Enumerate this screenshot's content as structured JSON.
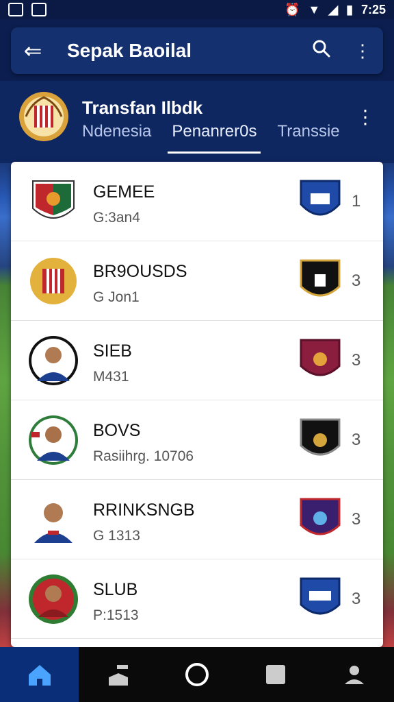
{
  "status_bar": {
    "time": "7:25"
  },
  "app_bar": {
    "title": "Sepak Baoilal",
    "back_icon": "arrow-left-icon",
    "search_icon": "search-icon",
    "more_icon": "more-vert-icon"
  },
  "header": {
    "title": "Transfan Ilbdk",
    "tabs": [
      {
        "label": "Ndenesia"
      },
      {
        "label": "Penanrer0s"
      },
      {
        "label": "Transsie"
      }
    ],
    "active_tab": 1
  },
  "rows": [
    {
      "name": "GEMEE",
      "sub": "G:3an4",
      "num": "1"
    },
    {
      "name": "BR9OUSDS",
      "sub": "G Jon1",
      "num": "3"
    },
    {
      "name": "SIEB",
      "sub": "M431",
      "num": "3"
    },
    {
      "name": "BOVS",
      "sub": "Rasiihrg. 10706",
      "num": "3"
    },
    {
      "name": "RRINKSNGB",
      "sub": "G 1313",
      "num": "3"
    },
    {
      "name": "SLUB",
      "sub": "P:1513",
      "num": "3"
    }
  ],
  "colors": {
    "primary": "#14306f",
    "header_bg": "#0e2760",
    "nav_active": "#0b2e78"
  },
  "bottom_nav": [
    {
      "icon": "home-icon"
    },
    {
      "icon": "stadium-icon"
    },
    {
      "icon": "circle-icon"
    },
    {
      "icon": "square-icon"
    },
    {
      "icon": "profile-icon"
    }
  ]
}
